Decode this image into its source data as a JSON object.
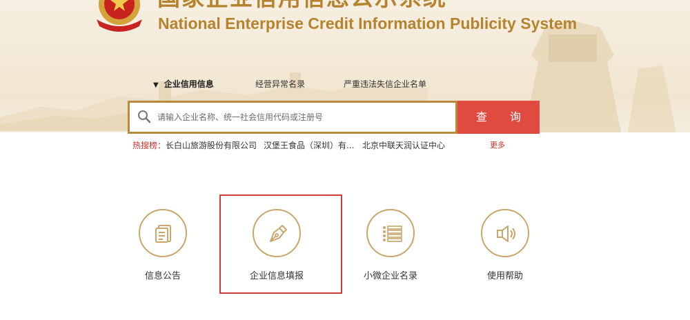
{
  "header": {
    "title_cn": "国家企业信用信息公示系统",
    "title_en": "National Enterprise Credit Information Publicity System"
  },
  "tabs": [
    {
      "label": "企业信用信息",
      "active": true
    },
    {
      "label": "经营异常名录",
      "active": false
    },
    {
      "label": "严重违法失信企业名单",
      "active": false
    }
  ],
  "search": {
    "placeholder": "请输入企业名称、统一社会信用代码或注册号",
    "button_label": "查 询"
  },
  "hot_search": {
    "label": "热搜榜：",
    "items": [
      "长白山旅游股份有限公司",
      "汉堡王食品（深圳）有...",
      "北京中联天润认证中心"
    ],
    "more_label": "更多"
  },
  "features": [
    {
      "label": "信息公告",
      "icon": "document-icon"
    },
    {
      "label": "企业信息填报",
      "icon": "pen-icon"
    },
    {
      "label": "小微企业名录",
      "icon": "list-icon"
    },
    {
      "label": "使用帮助",
      "icon": "speaker-icon"
    }
  ],
  "colors": {
    "gold": "#b5832e",
    "search_border": "#b78a3c",
    "search_button": "#e04a3f",
    "hot_red": "#d0312d",
    "icon_ring": "#c9a56a",
    "highlight": "#d43a3a"
  }
}
